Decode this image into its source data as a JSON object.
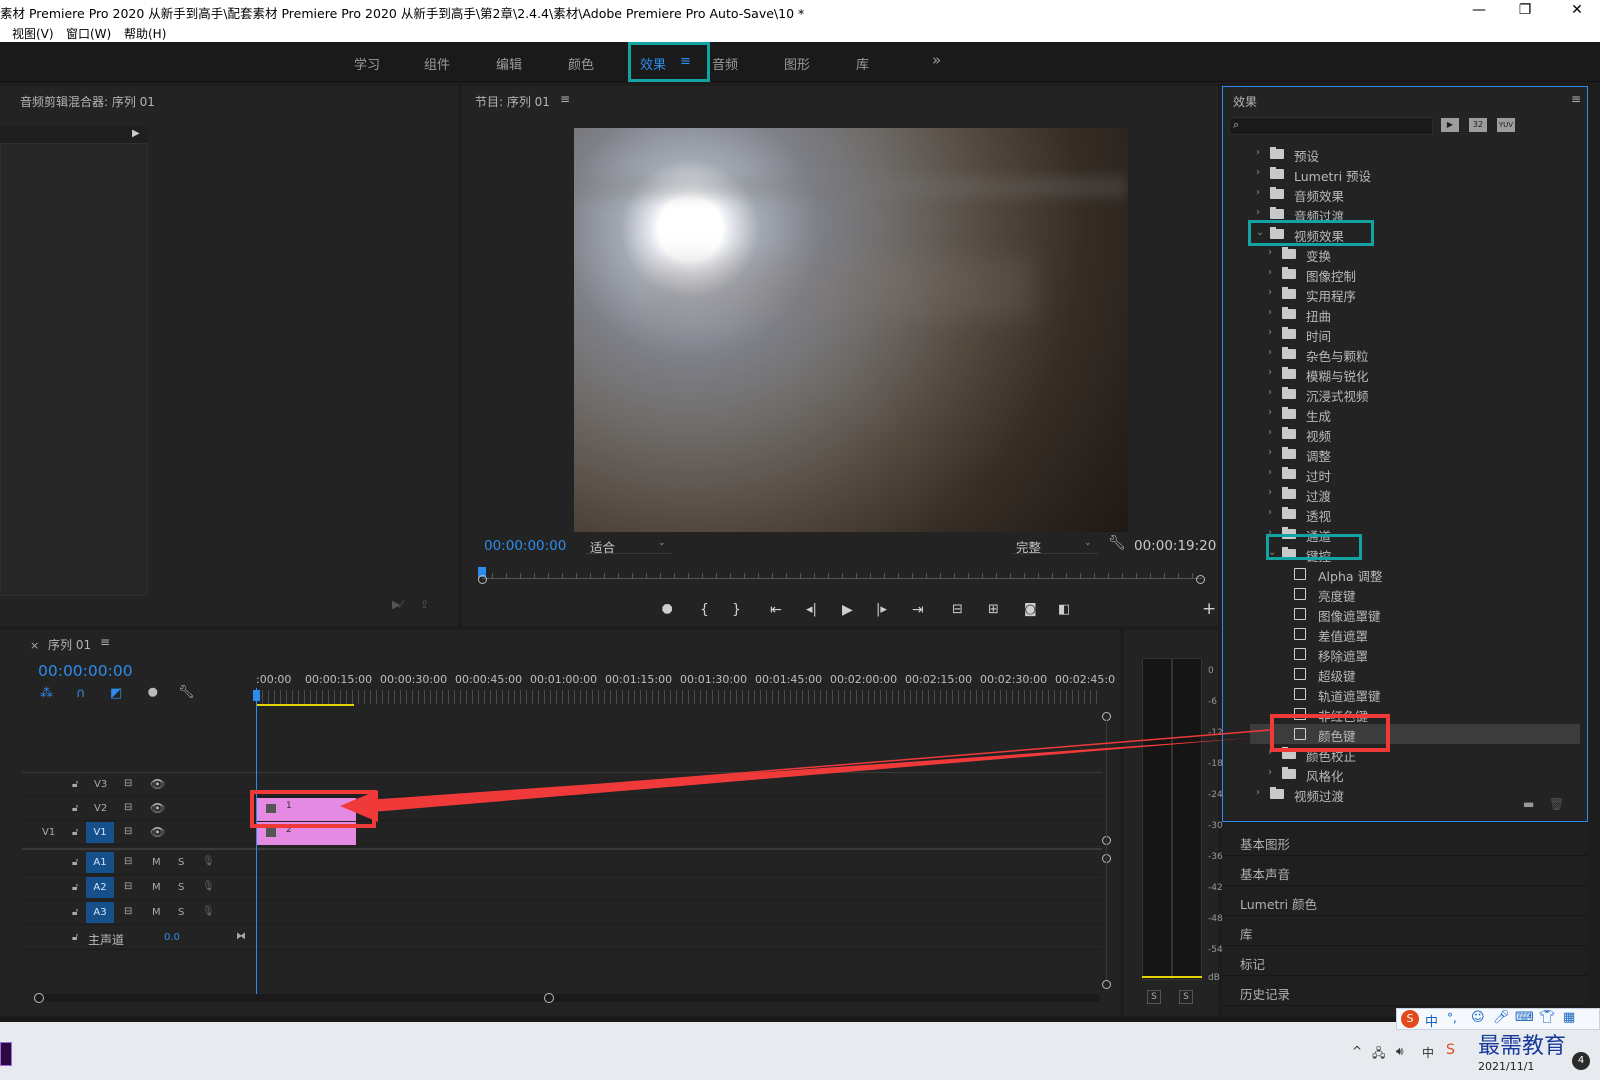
{
  "window": {
    "title": "素材 Premiere Pro 2020 从新手到高手\\配套素材 Premiere Pro 2020 从新手到高手\\第2章\\2.4.4\\素材\\Adobe Premiere Pro Auto-Save\\10 *",
    "controls": {
      "minimize": "—",
      "restore": "❐",
      "close": "✕"
    }
  },
  "menu": [
    "视图(V)",
    "窗口(W)",
    "帮助(H)"
  ],
  "workspaces": {
    "tabs": [
      "学习",
      "组件",
      "编辑",
      "颜色",
      "效果",
      "音频",
      "图形",
      "库"
    ],
    "active": "效果",
    "active_menu_glyph": "≡",
    "more": "»"
  },
  "audio_clip_mixer": {
    "title": "音频剪辑混合器: 序列 01"
  },
  "program_monitor": {
    "title": "节目: 序列 01",
    "menu_glyph": "≡",
    "timecode_current": "00:00:00:00",
    "fit": "适合",
    "quality": "完整",
    "duration": "00:00:19:20"
  },
  "effects_panel": {
    "title": "效果",
    "menu_glyph": "≡",
    "search_placeholder": "",
    "tool_icons": [
      "accelerated-effects-icon",
      "32bit-icon",
      "yuv-icon"
    ],
    "tool_labels": [
      "▶",
      "32",
      "YUV"
    ],
    "tree": [
      {
        "label": "预设",
        "level": 0,
        "expanded": false,
        "kind": "folder-star"
      },
      {
        "label": "Lumetri 预设",
        "level": 0,
        "expanded": false,
        "kind": "folder-star"
      },
      {
        "label": "音频效果",
        "level": 0,
        "expanded": false,
        "kind": "folder"
      },
      {
        "label": "音频过渡",
        "level": 0,
        "expanded": false,
        "kind": "folder"
      },
      {
        "label": "视频效果",
        "level": 0,
        "expanded": true,
        "kind": "folder"
      },
      {
        "label": "变换",
        "level": 1,
        "expanded": false,
        "kind": "folder"
      },
      {
        "label": "图像控制",
        "level": 1,
        "expanded": false,
        "kind": "folder"
      },
      {
        "label": "实用程序",
        "level": 1,
        "expanded": false,
        "kind": "folder"
      },
      {
        "label": "扭曲",
        "level": 1,
        "expanded": false,
        "kind": "folder"
      },
      {
        "label": "时间",
        "level": 1,
        "expanded": false,
        "kind": "folder"
      },
      {
        "label": "杂色与颗粒",
        "level": 1,
        "expanded": false,
        "kind": "folder"
      },
      {
        "label": "模糊与锐化",
        "level": 1,
        "expanded": false,
        "kind": "folder"
      },
      {
        "label": "沉浸式视频",
        "level": 1,
        "expanded": false,
        "kind": "folder"
      },
      {
        "label": "生成",
        "level": 1,
        "expanded": false,
        "kind": "folder"
      },
      {
        "label": "视频",
        "level": 1,
        "expanded": false,
        "kind": "folder"
      },
      {
        "label": "调整",
        "level": 1,
        "expanded": false,
        "kind": "folder"
      },
      {
        "label": "过时",
        "level": 1,
        "expanded": false,
        "kind": "folder"
      },
      {
        "label": "过渡",
        "level": 1,
        "expanded": false,
        "kind": "folder"
      },
      {
        "label": "透视",
        "level": 1,
        "expanded": false,
        "kind": "folder"
      },
      {
        "label": "通道",
        "level": 1,
        "expanded": false,
        "kind": "folder"
      },
      {
        "label": "键控",
        "level": 1,
        "expanded": true,
        "kind": "folder"
      },
      {
        "label": "Alpha 调整",
        "level": 2,
        "kind": "effect"
      },
      {
        "label": "亮度键",
        "level": 2,
        "kind": "effect"
      },
      {
        "label": "图像遮罩键",
        "level": 2,
        "kind": "effect"
      },
      {
        "label": "差值遮罩",
        "level": 2,
        "kind": "effect"
      },
      {
        "label": "移除遮罩",
        "level": 2,
        "kind": "effect"
      },
      {
        "label": "超级键",
        "level": 2,
        "kind": "effect"
      },
      {
        "label": "轨道遮罩键",
        "level": 2,
        "kind": "effect"
      },
      {
        "label": "非红色键",
        "level": 2,
        "kind": "effect"
      },
      {
        "label": "颜色键",
        "level": 2,
        "kind": "effect",
        "selected": true
      },
      {
        "label": "颜色校正",
        "level": 1,
        "expanded": false,
        "kind": "folder"
      },
      {
        "label": "风格化",
        "level": 1,
        "expanded": false,
        "kind": "folder"
      },
      {
        "label": "视频过渡",
        "level": 0,
        "expanded": false,
        "kind": "folder"
      }
    ]
  },
  "collapsed_panels": [
    "基本图形",
    "基本声音",
    "Lumetri 颜色",
    "库",
    "标记",
    "历史记录"
  ],
  "timeline": {
    "tab_close": "×",
    "title": "序列 01",
    "menu_glyph": "≡",
    "timecode": "00:00:00:00",
    "ruler": [
      ":00:00",
      "00:00:15:00",
      "00:00:30:00",
      "00:00:45:00",
      "00:01:00:00",
      "00:01:15:00",
      "00:01:30:00",
      "00:01:45:00",
      "00:02:00:00",
      "00:02:15:00",
      "00:02:30:00",
      "00:02:45:0"
    ],
    "video_tracks": [
      {
        "name": "V3",
        "source": ""
      },
      {
        "name": "V2",
        "source": ""
      },
      {
        "name": "V1",
        "source": "V1"
      }
    ],
    "audio_tracks": [
      {
        "name": "A1",
        "m": "M",
        "s": "S"
      },
      {
        "name": "A2",
        "m": "M",
        "s": "S"
      },
      {
        "name": "A3",
        "m": "M",
        "s": "S"
      }
    ],
    "master": {
      "label": "主声道",
      "value": "0.0"
    },
    "clips": [
      {
        "label": "1",
        "track": "V2"
      },
      {
        "label": "2",
        "track": "V1"
      }
    ]
  },
  "audio_meter": {
    "scale": [
      "0",
      "-6",
      "-12",
      "-18",
      "-24",
      "-30",
      "-36",
      "-42",
      "-48",
      "-54",
      "dB"
    ],
    "solo": [
      "S",
      "S"
    ]
  },
  "taskbar": {
    "ime": "中",
    "date": "2021/11/1",
    "watermark": "最需教育",
    "notification_count": "4"
  },
  "colors": {
    "accent_blue": "#2d8ceb",
    "highlight_teal": "#13a3a3",
    "annotation_red": "#f03a3a",
    "clip_pink": "#e58ae3"
  }
}
